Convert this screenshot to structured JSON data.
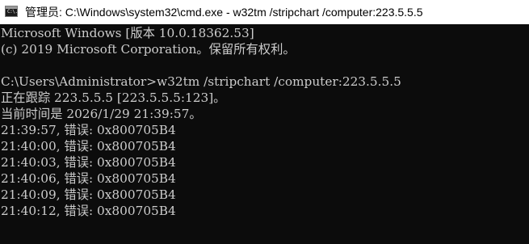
{
  "window": {
    "title": "管理员: C:\\Windows\\system32\\cmd.exe - w32tm  /stripchart /computer:223.5.5.5",
    "icon_label": "C:\\."
  },
  "console": {
    "lines": [
      "Microsoft Windows [版本 10.0.18362.53]",
      "(c) 2019 Microsoft Corporation。保留所有权利。",
      "",
      "C:\\Users\\Administrator>w32tm /stripchart /computer:223.5.5.5",
      "正在跟踪 223.5.5.5 [223.5.5.5:123]。",
      "当前时间是 2026/1/29 21:39:57。",
      "21:39:57, 错误: 0x800705B4",
      "21:40:00, 错误: 0x800705B4",
      "21:40:03, 错误: 0x800705B4",
      "21:40:06, 错误: 0x800705B4",
      "21:40:09, 错误: 0x800705B4",
      "21:40:12, 错误: 0x800705B4"
    ]
  },
  "colors": {
    "console_background": "#0c0c0c",
    "console_text": "#cccccc",
    "titlebar_background": "#ffffff",
    "title_text": "#000000"
  }
}
